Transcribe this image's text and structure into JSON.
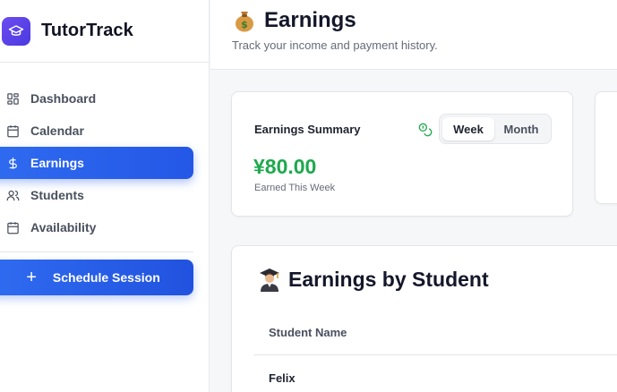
{
  "app": {
    "name": "TutorTrack"
  },
  "sidebar": {
    "items": [
      {
        "label": "Dashboard",
        "icon": "dashboard-icon",
        "active": false
      },
      {
        "label": "Calendar",
        "icon": "calendar-icon",
        "active": false
      },
      {
        "label": "Earnings",
        "icon": "dollar-icon",
        "active": true
      },
      {
        "label": "Students",
        "icon": "users-icon",
        "active": false
      },
      {
        "label": "Availability",
        "icon": "calendar-icon",
        "active": false
      }
    ],
    "cta_label": "Schedule Session"
  },
  "page": {
    "title": "Earnings",
    "title_icon": "money-bag-icon",
    "subtitle": "Track your income and payment history."
  },
  "summary": {
    "title": "Earnings Summary",
    "toggle": {
      "options": [
        "Week",
        "Month"
      ],
      "selected": "Week"
    },
    "amount": "¥80.00",
    "amount_caption": "Earned This Week"
  },
  "by_student": {
    "title": "Earnings by Student",
    "title_icon": "student-icon",
    "columns": [
      "Student Name"
    ],
    "rows": [
      {
        "name": "Felix"
      }
    ]
  },
  "colors": {
    "accent": "#2457e6",
    "brand_logo": "#5b43e8",
    "amount": "#1ea94d"
  }
}
